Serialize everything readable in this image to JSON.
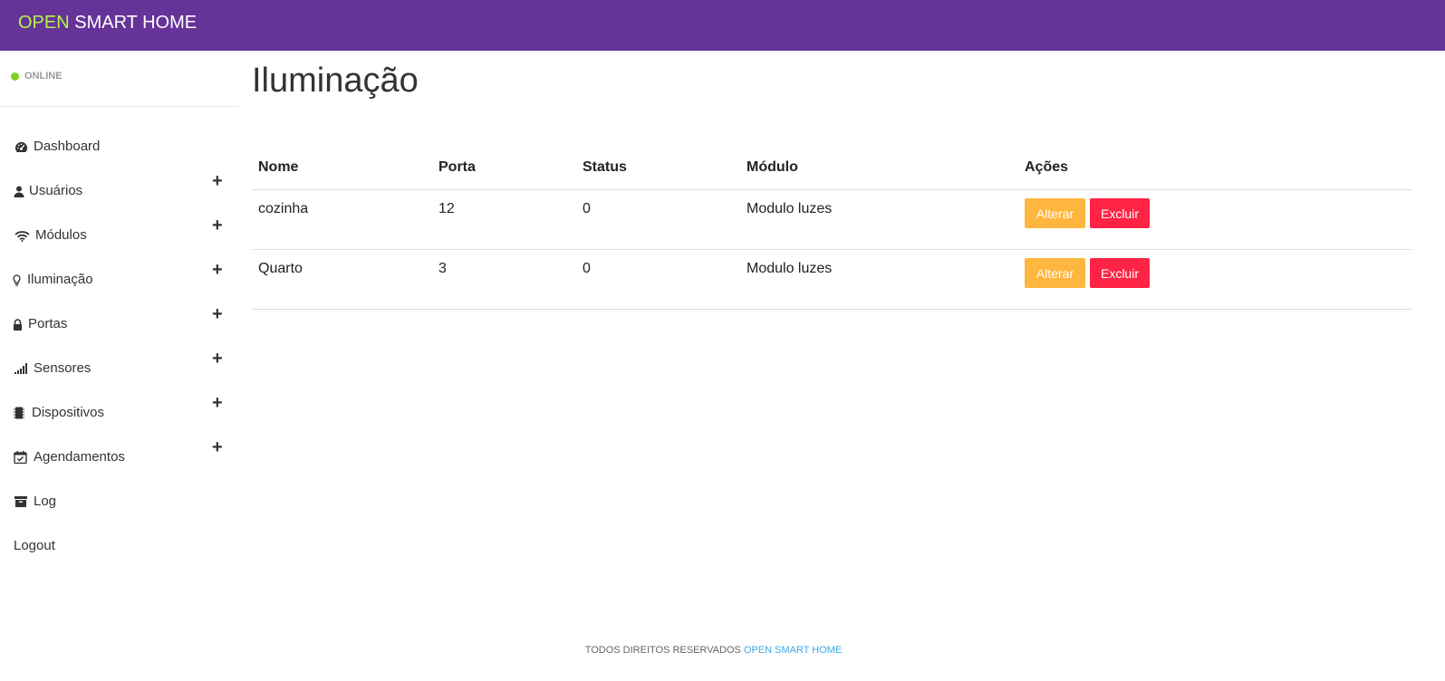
{
  "header": {
    "brand_accent": "OPEN",
    "brand_rest": " SMART HOME",
    "brand_color": "#663399",
    "accent_color": "#b5f34a"
  },
  "sidebar": {
    "status": {
      "text": "ONLINE",
      "color": "#7ed321"
    },
    "items": [
      {
        "label": "Dashboard",
        "icon": "dashboard-icon",
        "expandable": false
      },
      {
        "label": "Usuários",
        "icon": "user-icon",
        "expandable": true,
        "expand_symbol": "+"
      },
      {
        "label": "Módulos",
        "icon": "wifi-icon",
        "expandable": true,
        "expand_symbol": "+"
      },
      {
        "label": "Iluminação",
        "icon": "lightbulb-icon",
        "expandable": true,
        "expand_symbol": "+"
      },
      {
        "label": "Portas",
        "icon": "lock-icon",
        "expandable": true,
        "expand_symbol": "+"
      },
      {
        "label": "Sensores",
        "icon": "signal-icon",
        "expandable": true,
        "expand_symbol": "+"
      },
      {
        "label": "Dispositivos",
        "icon": "chip-icon",
        "expandable": true,
        "expand_symbol": "+"
      },
      {
        "label": "Agendamentos",
        "icon": "calendar-check-icon",
        "expandable": true,
        "expand_symbol": "+"
      },
      {
        "label": "Log",
        "icon": "archive-icon",
        "expandable": false
      },
      {
        "label": "Logout",
        "icon": "",
        "expandable": false
      }
    ]
  },
  "main": {
    "title": "Iluminação",
    "table": {
      "headers": [
        "Nome",
        "Porta",
        "Status",
        "Módulo",
        "Ações"
      ],
      "rows": [
        {
          "nome": "cozinha",
          "porta": "12",
          "status": "0",
          "modulo": "Modulo luzes"
        },
        {
          "nome": "Quarto",
          "porta": "3",
          "status": "0",
          "modulo": "Modulo luzes"
        }
      ],
      "actions": {
        "edit_label": "Alterar",
        "delete_label": "Excluir",
        "edit_color": "#ffb63f",
        "delete_color": "#ff2345"
      }
    }
  },
  "footer": {
    "text": "TODOS DIREITOS RESERVADOS ",
    "link": "OPEN SMART HOME",
    "link_color": "#3ea8e5"
  }
}
